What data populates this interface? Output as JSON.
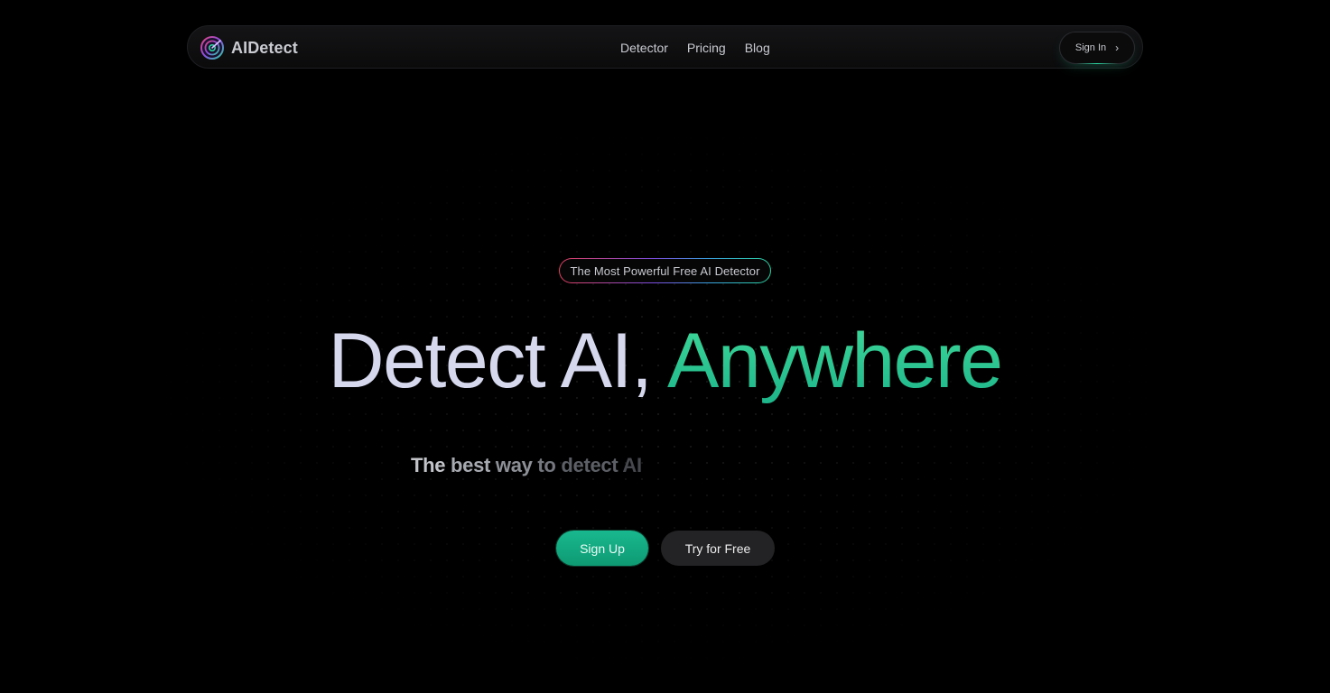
{
  "brand": {
    "name": "AIDetect",
    "logo_icon": "radar-target-icon"
  },
  "nav": {
    "links": [
      {
        "label": "Detector"
      },
      {
        "label": "Pricing"
      },
      {
        "label": "Blog"
      }
    ],
    "sign_in_label": "Sign In",
    "sign_in_icon": "chevron-right-icon",
    "sign_in_chevron": "›"
  },
  "hero": {
    "badge": "The Most Powerful Free AI Detector",
    "headline_part1": "Detect AI, ",
    "headline_part2": "Anywhere",
    "typing_words": [
      "The",
      "best",
      "way",
      "to",
      "detect",
      "AI"
    ],
    "cta_primary": "Sign Up",
    "cta_secondary": "Try for Free"
  },
  "colors": {
    "background": "#000000",
    "accent": "#1db58a",
    "headline_light": "#d6d9ee",
    "secondary_button": "#232325"
  }
}
